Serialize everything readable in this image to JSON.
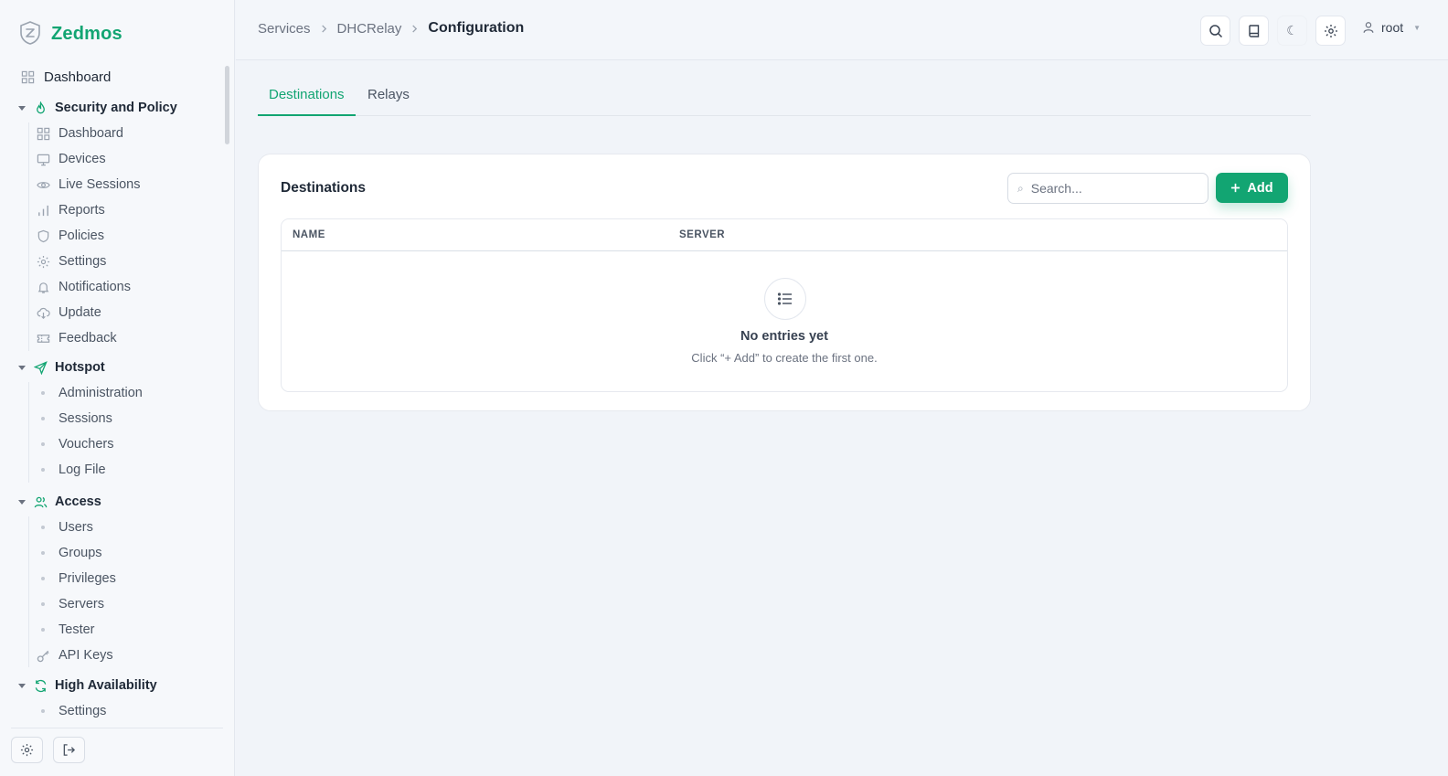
{
  "brand": {
    "name": "Zedmos"
  },
  "sidebar": {
    "top_item": {
      "label": "Dashboard",
      "icon": "grid-icon"
    },
    "sections": [
      {
        "title": "Security and Policy",
        "icon": "flame-icon",
        "items": [
          {
            "label": "Dashboard",
            "icon": "grid-icon"
          },
          {
            "label": "Devices",
            "icon": "monitor-icon"
          },
          {
            "label": "Live Sessions",
            "icon": "eye-icon"
          },
          {
            "label": "Reports",
            "icon": "bar-chart-icon"
          },
          {
            "label": "Policies",
            "icon": "shield-icon"
          },
          {
            "label": "Settings",
            "icon": "gear-icon"
          },
          {
            "label": "Notifications",
            "icon": "bell-icon"
          },
          {
            "label": "Update",
            "icon": "cloud-download-icon"
          },
          {
            "label": "Feedback",
            "icon": "ticket-icon"
          }
        ]
      },
      {
        "title": "Hotspot",
        "icon": "send-icon",
        "items": [
          {
            "label": "Administration"
          },
          {
            "label": "Sessions"
          },
          {
            "label": "Vouchers"
          },
          {
            "label": "Log File"
          }
        ]
      },
      {
        "title": "Access",
        "icon": "users-icon",
        "items": [
          {
            "label": "Users"
          },
          {
            "label": "Groups"
          },
          {
            "label": "Privileges"
          },
          {
            "label": "Servers"
          },
          {
            "label": "Tester"
          },
          {
            "label": "API Keys",
            "icon": "key-icon"
          }
        ]
      },
      {
        "title": "High Availability",
        "icon": "refresh-icon",
        "items": [
          {
            "label": "Settings"
          }
        ]
      }
    ],
    "footer": {
      "settings_icon": "gear-icon",
      "logout_icon": "logout-icon"
    }
  },
  "header": {
    "breadcrumb": [
      "Services",
      "DHCRelay",
      "Configuration"
    ],
    "user": "root",
    "icons": [
      "search-icon",
      "book-icon",
      "moon-icon",
      "gear-icon",
      "user-icon"
    ]
  },
  "tabs": [
    {
      "label": "Destinations",
      "active": true
    },
    {
      "label": "Relays",
      "active": false
    }
  ],
  "card": {
    "title": "Destinations",
    "search_placeholder": "Search...",
    "add_label": "Add",
    "columns": [
      "NAME",
      "SERVER"
    ],
    "rows": [],
    "empty_title": "No entries yet",
    "empty_subtitle": "Click “+ Add” to create the first one."
  },
  "colors": {
    "accent": "#12a572",
    "background": "#f1f4f9",
    "text": "#1f2937"
  }
}
